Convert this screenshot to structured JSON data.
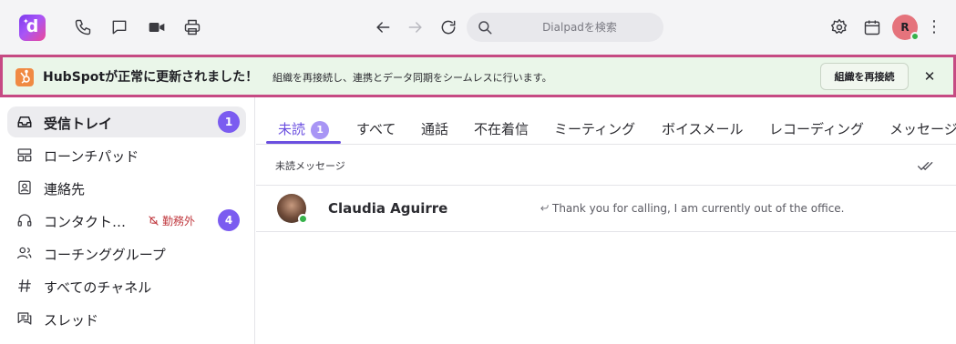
{
  "topbar": {
    "search_placeholder": "Dialpadを検索",
    "avatar_initial": "R"
  },
  "banner": {
    "title": "HubSpotが正常に更新されました！",
    "message": "組織を再接続し、連携とデータ同期をシームレスに行います。",
    "button_label": "組織を再接続",
    "close_glyph": "✕"
  },
  "sidebar": {
    "items": [
      {
        "label": "受信トレイ",
        "badge": "1",
        "icon": "inbox-icon"
      },
      {
        "label": "ローンチパッド",
        "icon": "launchpad-icon"
      },
      {
        "label": "連絡先",
        "icon": "contacts-icon"
      },
      {
        "label": "コンタクト…",
        "status": "勤務外",
        "badge": "4",
        "icon": "headset-icon"
      },
      {
        "label": "コーチンググループ",
        "icon": "group-icon"
      },
      {
        "label": "すべてのチャネル",
        "icon": "hash-icon"
      },
      {
        "label": "スレッド",
        "icon": "threads-icon"
      }
    ]
  },
  "tabs": [
    {
      "label": "未読",
      "badge": "1"
    },
    {
      "label": "すべて"
    },
    {
      "label": "通話"
    },
    {
      "label": "不在着信"
    },
    {
      "label": "ミーティング"
    },
    {
      "label": "ボイスメール"
    },
    {
      "label": "レコーディング"
    },
    {
      "label": "メッセージ"
    }
  ],
  "section_title": "未読メッセージ",
  "conversations": [
    {
      "name": "Claudia Aguirre",
      "preview": "Thank you for calling, I am currently out of the office."
    }
  ],
  "colors": {
    "accent": "#6b4fe0",
    "badge": "#7b5cf0",
    "banner_bg": "#eaf6e9",
    "banner_border": "#c64a83",
    "online": "#36b24a",
    "dnd": "#c0393f"
  }
}
